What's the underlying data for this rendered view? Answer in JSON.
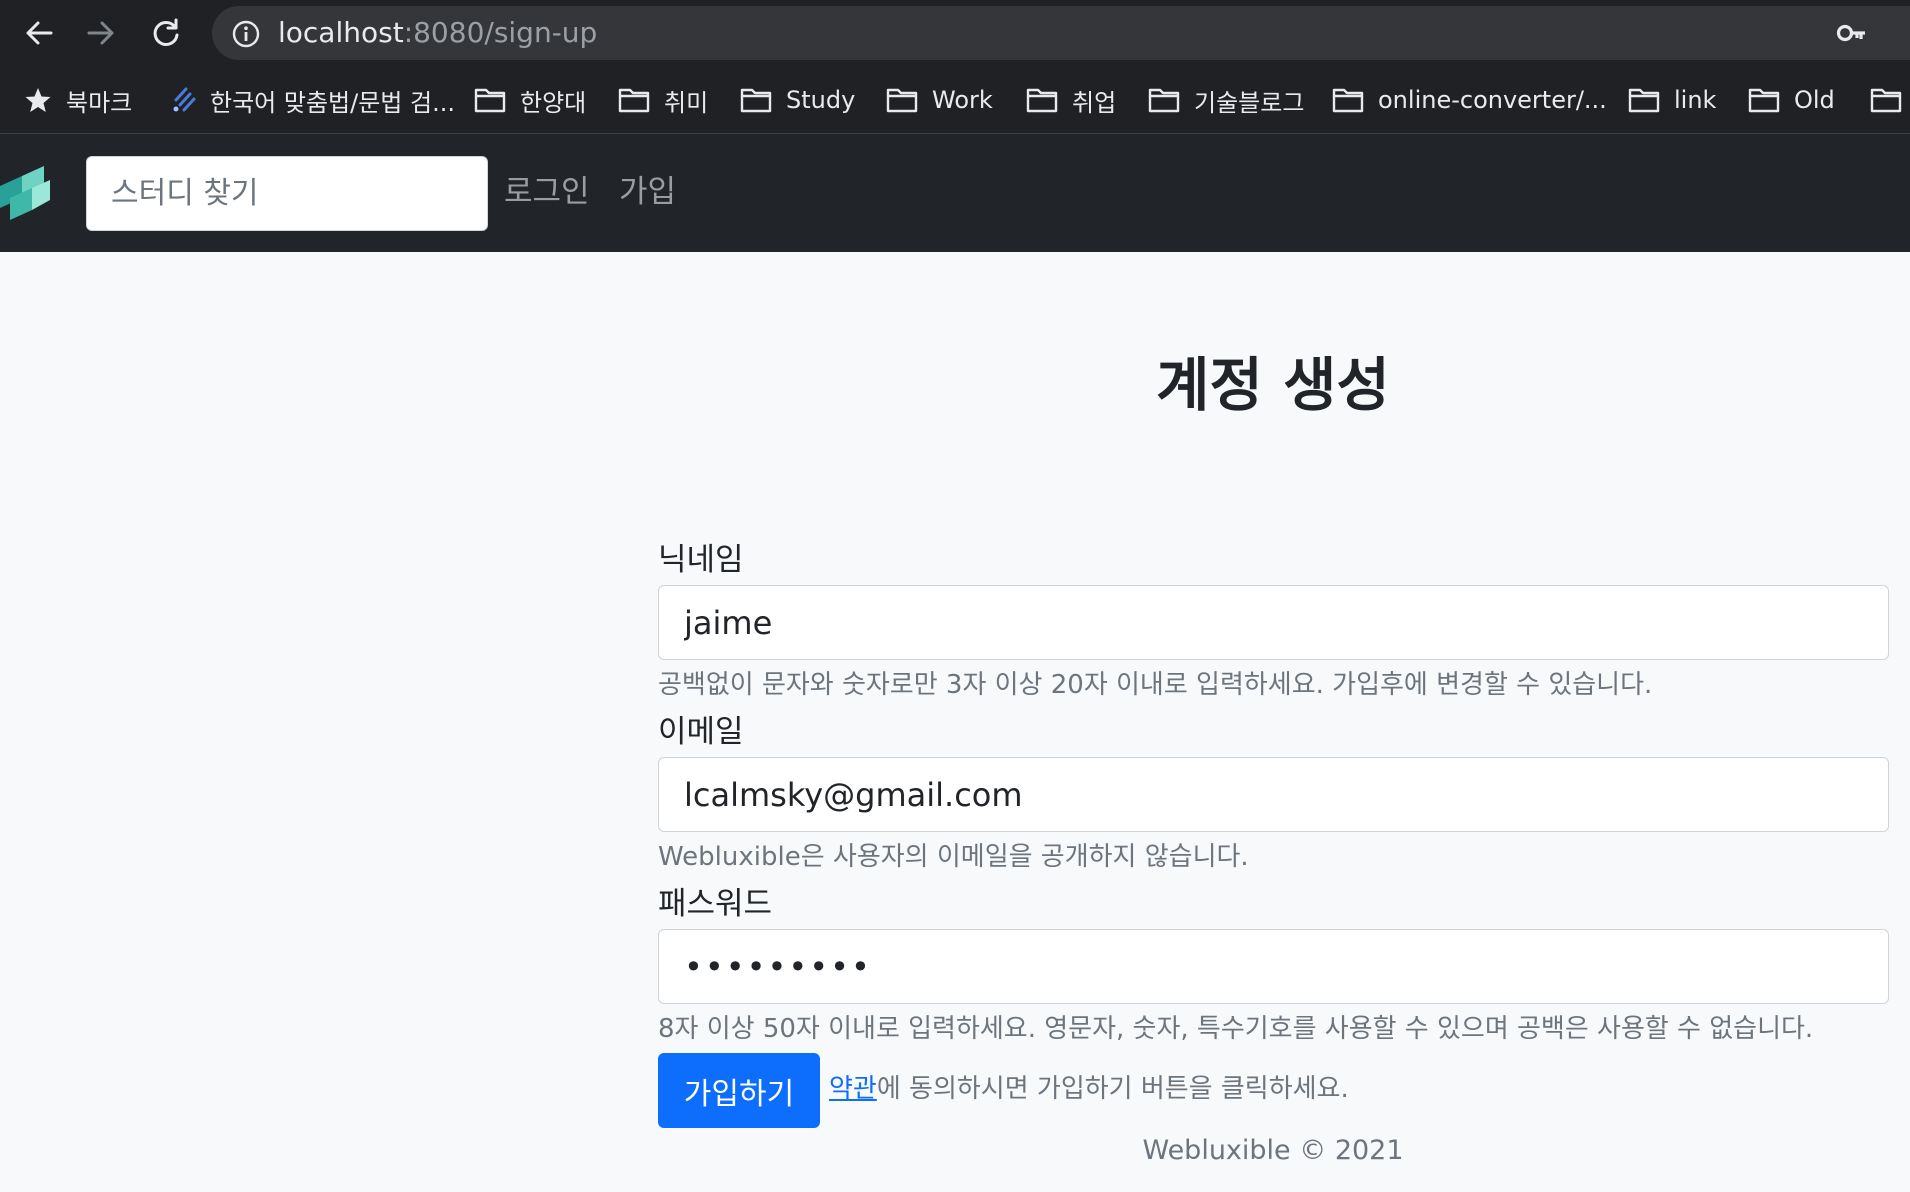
{
  "browser": {
    "url_host": "localhost",
    "url_path": ":8080/sign-up",
    "bookmarks": [
      {
        "label": "북마크",
        "icon": "star-icon"
      },
      {
        "label": "한국어 맞춤법/문법 검...",
        "icon": "spellcheck-favicon-icon"
      },
      {
        "label": "한양대",
        "icon": "folder-icon"
      },
      {
        "label": "취미",
        "icon": "folder-icon"
      },
      {
        "label": "Study",
        "icon": "folder-icon"
      },
      {
        "label": "Work",
        "icon": "folder-icon"
      },
      {
        "label": "취업",
        "icon": "folder-icon"
      },
      {
        "label": "기술블로그",
        "icon": "folder-icon"
      },
      {
        "label": "online-converter/...",
        "icon": "folder-icon"
      },
      {
        "label": "link",
        "icon": "folder-icon"
      },
      {
        "label": "Old",
        "icon": "folder-icon"
      }
    ]
  },
  "navbar": {
    "logo_icon": "webluxible-logo-icon",
    "search_placeholder": "스터디 찾기",
    "login_label": "로그인",
    "signup_label": "가입"
  },
  "form": {
    "title": "계정 생성",
    "nickname": {
      "label": "닉네임",
      "value": "jaime",
      "help": "공백없이 문자와 숫자로만 3자 이상 20자 이내로 입력하세요. 가입후에 변경할 수 있습니다."
    },
    "email": {
      "label": "이메일",
      "value": "lcalmsky@gmail.com",
      "help": "Webluxible은 사용자의 이메일을 공개하지 않습니다."
    },
    "password": {
      "label": "패스워드",
      "value": "•••••••••",
      "help": "8자 이상 50자 이내로 입력하세요. 영문자, 숫자, 특수기호를 사용할 수 있으며 공백은 사용할 수 없습니다."
    },
    "submit_label": "가입하기",
    "terms_link": "약관",
    "terms_text": "에 동의하시면 가입하기 버튼을 클릭하세요."
  },
  "footer": {
    "text": "Webluxible © 2021"
  },
  "colors": {
    "primary": "#0d6efd",
    "navbar_bg": "#212529",
    "page_bg": "#f8f9fa",
    "chrome_bg": "#202124"
  }
}
